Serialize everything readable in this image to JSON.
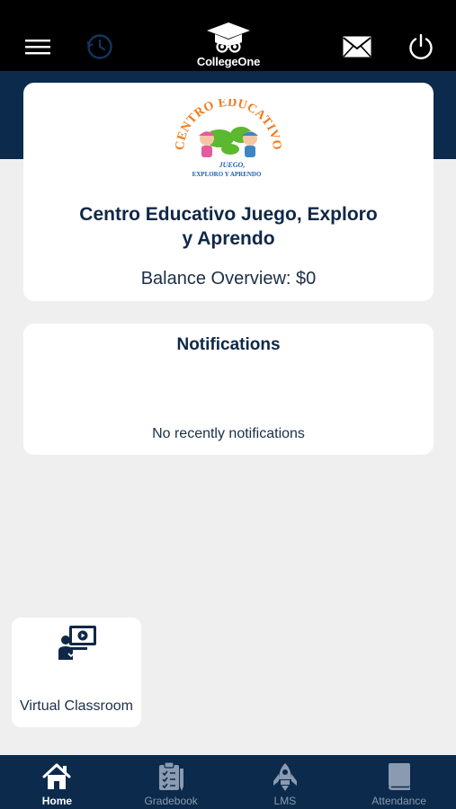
{
  "header": {
    "brand_name": "CollegeOne",
    "icons": [
      "menu-icon",
      "clock-icon",
      "mail-icon",
      "power-icon"
    ]
  },
  "school": {
    "name_line1": "Centro Educativo Juego, Exploro",
    "name_line2": "y Aprendo",
    "balance": "Balance Overview: $0",
    "logo_text_top": "CENTRO EDUCATIVO",
    "logo_text_bottom1": "JUEGO,",
    "logo_text_bottom2": "EXPLORO Y APRENDO"
  },
  "notifications": {
    "title": "Notifications",
    "empty_text": "No recently notifications"
  },
  "shortcuts": [
    {
      "label": "Virtual Classroom",
      "icon": "virtual-classroom-icon"
    }
  ],
  "tabs": [
    {
      "label": "Home",
      "icon": "home-icon",
      "active": true
    },
    {
      "label": "Gradebook",
      "icon": "gradebook-icon",
      "active": false
    },
    {
      "label": "LMS",
      "icon": "rocket-icon",
      "active": false
    },
    {
      "label": "Attendance",
      "icon": "book-icon",
      "active": false
    }
  ],
  "colors": {
    "navy": "#0b2a4c",
    "text_dark": "#0f2847",
    "background": "#efefef",
    "logo_orange": "#f07b1d",
    "logo_green": "#5cb82e"
  }
}
